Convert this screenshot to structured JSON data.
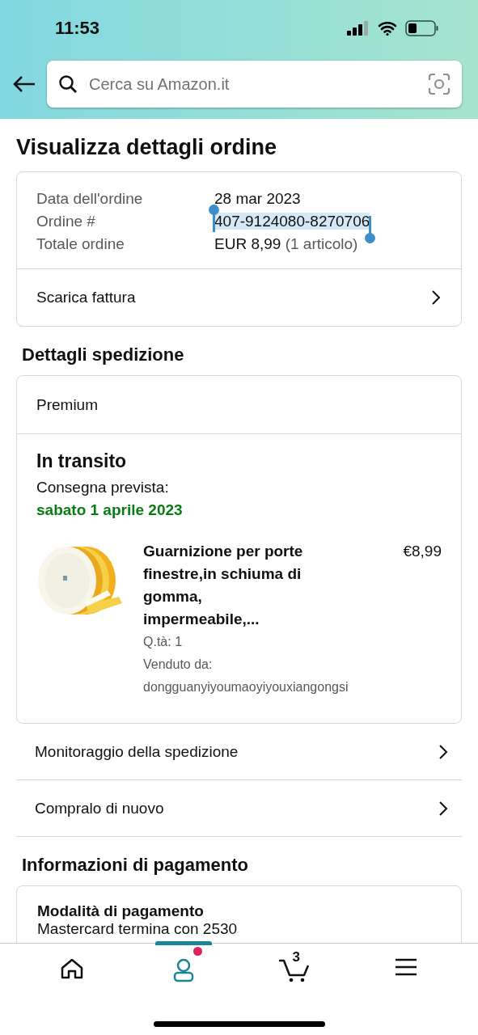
{
  "status_bar": {
    "time": "11:53"
  },
  "search": {
    "placeholder": "Cerca su Amazon.it"
  },
  "page_title": "Visualizza dettagli ordine",
  "order_summary": {
    "rows": [
      {
        "label": "Data dell'ordine",
        "value": "28 mar 2023",
        "selected": false
      },
      {
        "label": "Ordine #",
        "value": "407-9124080-8270706",
        "selected": true
      },
      {
        "label": "Totale ordine",
        "value": "EUR 8,99",
        "note": "(1 articolo)",
        "selected": false
      }
    ],
    "link": "Scarica fattura"
  },
  "shipping": {
    "heading": "Dettagli spedizione",
    "service": "Premium",
    "status": "In transito",
    "delivery_label": "Consegna prevista:",
    "delivery_date": "sabato 1 aprile 2023",
    "item": {
      "kind": "picture",
      "title": "Guarnizione per porte finestre,in schiuma di gomma, impermeabile,...",
      "price": "€8,99",
      "quantity": "Q.tà: 1",
      "seller_label": "Venduto da:",
      "seller": "dongguanyiyoumaoyiyouxiangongsi"
    }
  },
  "actions": [
    "Monitoraggio della spedizione",
    "Compralo di nuovo"
  ],
  "payment": {
    "heading": "Informazioni di pagamento",
    "method_label": "Modalità di pagamento",
    "method": "Mastercard termina con 2530"
  },
  "bottom_nav": [
    {
      "kind": "home",
      "selected": false
    },
    {
      "kind": "account",
      "selected": true,
      "notification": true
    },
    {
      "kind": "cart",
      "selected": false,
      "count": "3"
    },
    {
      "kind": "menu",
      "selected": false
    }
  ]
}
